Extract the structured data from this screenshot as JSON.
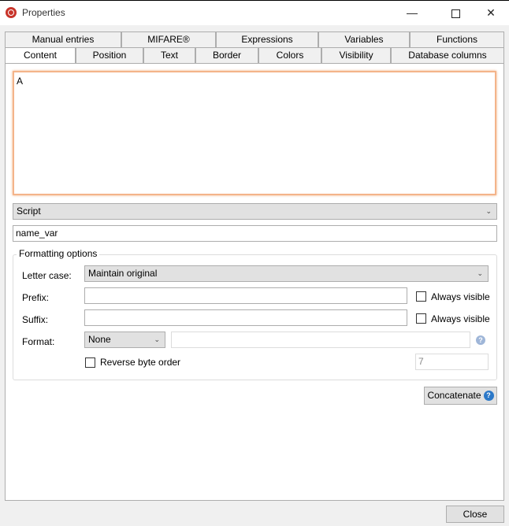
{
  "window": {
    "title": "Properties",
    "minimize_glyph": "—",
    "close_glyph": "✕"
  },
  "tabs": {
    "row1": [
      "Manual entries",
      "MIFARE®",
      "Expressions",
      "Variables",
      "Functions"
    ],
    "row2": [
      "Content",
      "Position",
      "Text",
      "Border",
      "Colors",
      "Visibility",
      "Database columns"
    ],
    "active": "Content"
  },
  "content": {
    "text": "A",
    "source_select": "Script",
    "field_value": "name_var"
  },
  "formatting": {
    "legend": "Formatting options",
    "letter_case_label": "Letter case:",
    "letter_case_value": "Maintain original",
    "prefix_label": "Prefix:",
    "prefix_value": "",
    "suffix_label": "Suffix:",
    "suffix_value": "",
    "always_visible_label": "Always visible",
    "format_label": "Format:",
    "format_value": "None",
    "format_param": "",
    "reverse_label": "Reverse byte order",
    "length_value": "7"
  },
  "buttons": {
    "concatenate": "Concatenate",
    "close": "Close"
  }
}
